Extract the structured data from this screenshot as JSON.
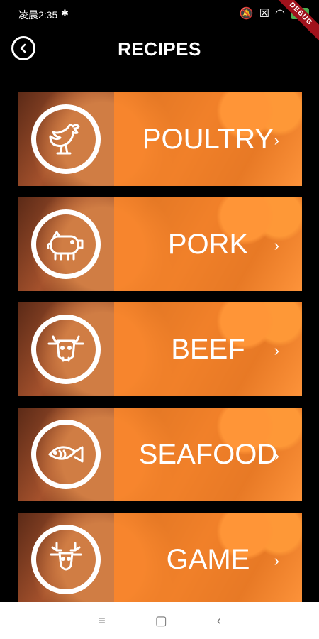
{
  "status": {
    "time": "凌晨2:35",
    "battery": "100"
  },
  "debug_banner": "DEBUG",
  "appbar": {
    "title": "RECIPES"
  },
  "categories": [
    {
      "label": "POULTRY",
      "icon": "chicken-icon"
    },
    {
      "label": "PORK",
      "icon": "pig-icon"
    },
    {
      "label": "BEEF",
      "icon": "cow-icon"
    },
    {
      "label": "SEAFOOD",
      "icon": "fish-icon"
    },
    {
      "label": "GAME",
      "icon": "deer-icon"
    }
  ],
  "chevron": "›",
  "navbar": {
    "menu": "≡",
    "home": "▢",
    "back": "‹"
  },
  "colors": {
    "overlay": "#ff8728",
    "background": "#000000"
  }
}
